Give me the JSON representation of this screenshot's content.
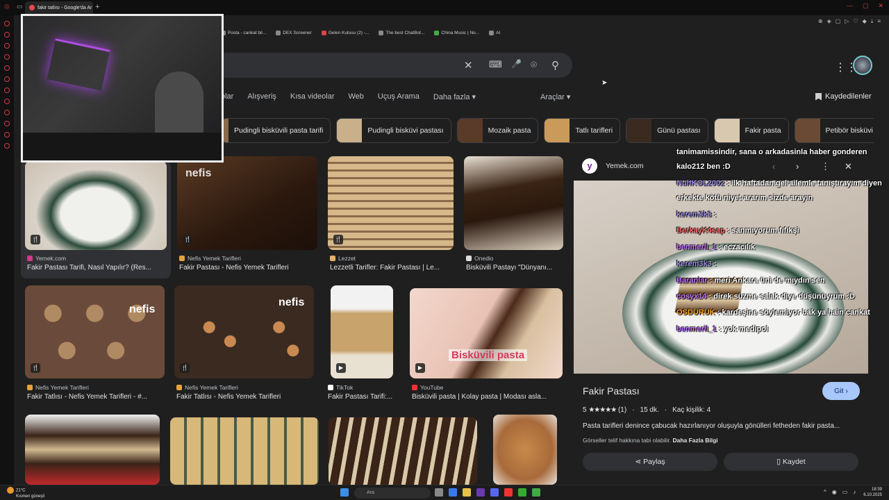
{
  "browser": {
    "tab_title": "fakir tatlısı - Google'da Ar",
    "new_tab": "+",
    "bookmarks": [
      "Posta - cankat bil...",
      "DEX Screener",
      "Gelen Kutusu (2) -...",
      "The best ChatBot...",
      "China Music | No...",
      "AI"
    ]
  },
  "search": {
    "clear_icon": "✕",
    "keyboard_icon": "⌨",
    "mic_icon": "🎤",
    "lens_icon": "⌾",
    "search_icon": "⚲",
    "apps_icon": "⋮⋮⋮"
  },
  "nav_tabs": [
    "olar",
    "Alışveriş",
    "Kısa videolar",
    "Web",
    "Uçuş Arama",
    "Daha fazla ▾"
  ],
  "tools": "Araçlar ▾",
  "saved": "Kaydedilenler",
  "chips": [
    {
      "label": "Pudingli bisküvili pasta tarifi",
      "color": "#8a6a4a"
    },
    {
      "label": "Pudingli bisküvi pastası",
      "color": "#c9b08a"
    },
    {
      "label": "Mozaik pasta",
      "color": "#5a3a28"
    },
    {
      "label": "Tatlı tarifleri",
      "color": "#c99a5a"
    },
    {
      "label": "Günü pastası",
      "color": "#3a2a20"
    },
    {
      "label": "Fakir pasta",
      "color": "#d8c8b0"
    },
    {
      "label": "Petibör bisküvi",
      "color": "#6a4a34"
    }
  ],
  "results": [
    {
      "source": "Yemek.com",
      "title": "Fakir Pastası Tarifi, Nasıl Yapılır? (Res...",
      "color": "#d9d2c8"
    },
    {
      "source": "Nefis Yemek Tarifleri",
      "title": "Fakir Pastası - Nefis Yemek Tarifleri",
      "color": "#3b2618",
      "watermark": "nefis"
    },
    {
      "source": "Lezzet",
      "title": "Lezzetli Tarifler: Fakir Pastası | Le...",
      "color": "#c9a57a"
    },
    {
      "source": "Onedio",
      "title": "Bisküvili Pastayı \"Dünyanı...",
      "color": "#2e1c12"
    },
    {
      "source": "Nefis Yemek Tarifleri",
      "title": "Fakir Tatlısı - Nefis Yemek Tarifleri - #...",
      "color": "#a37a52",
      "watermark": "nefis"
    },
    {
      "source": "Nefis Yemek Tarifleri",
      "title": "Fakir Tatlısı - Nefis Yemek Tarifleri",
      "color": "#8a5a34",
      "watermark": "nefis"
    },
    {
      "source": "TikTok",
      "title": "Fakir Pastası Tarifi:...",
      "color": "#c8a46c"
    },
    {
      "source": "YouTube",
      "title": "Bisküvili pasta | Kolay pasta | Modası asla...",
      "color": "#e8cfc4",
      "watermark": "Bisküvili pasta"
    }
  ],
  "panel": {
    "logo": "y",
    "site": "Yemek.com",
    "title": "Fakir Pastası",
    "visit": "Git ›",
    "rating": "5",
    "stars": "★★★★★",
    "count": "(1)",
    "time": "15 dk.",
    "servings": "Kaç kişilik: 4",
    "description": "Pasta tarifleri denince çabucak hazırlanıyor oluşuyla gönülleri fetheden fakir pasta...",
    "copyright": "Görseller telif hakkına tabi olabilir.",
    "more_info": "Daha Fazla Bilgi",
    "share": "Paylaş",
    "save": "Kaydet"
  },
  "chat": {
    "l1": "tanimamissindir, sana o arkadasinla haber gonderen",
    "l2": "kalo212 ben :D",
    "m3_user": "NuhKOL2002",
    "m3_text": ": ilk haftadan gel ailemle tanıştırayım diyen",
    "l4": "erkekte kötü niyet ararım sizde arayın",
    "m5_user": "kerem3k3",
    "m5_text": ":",
    "m6_user": "BerkayK4sap",
    "m6_text": ": sanmıyorum fıfıkşi",
    "m7_user": "benmeril_1",
    "m7_text": ": eczacılık",
    "m8_user": "kerem3k3",
    "m8_text": ":",
    "m9_user": "Baranlar",
    "m9_text": ": meri Ankara üni de mıydın sen",
    "m10_user": "cosyx14",
    "m10_text": ": direk süzme salak diye düşünüyrum :D",
    "m11_user": "OSDURUK",
    "m11_text": ": kardeşine söylemiyor bak ya hain cankat",
    "m12_user": "benmeril_1",
    "m12_text": ": yok medipol"
  },
  "taskbar": {
    "temp": "21°C",
    "weather": "Kısmen güneşli",
    "search": "Ara",
    "time": "18:39",
    "date": "6.10.2025"
  }
}
